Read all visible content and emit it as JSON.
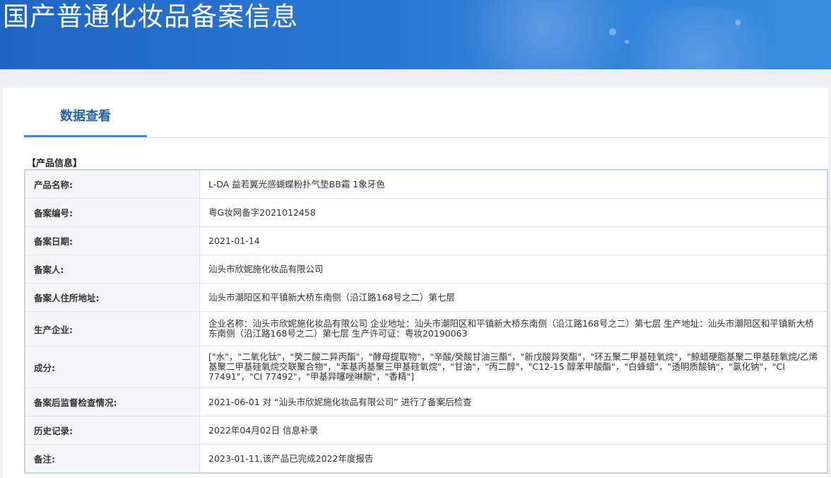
{
  "header": {
    "title": "国产普通化妆品备案信息"
  },
  "tabs": [
    {
      "label": "数据查看",
      "active": true
    }
  ],
  "section": {
    "title": "【产品信息】"
  },
  "rows": [
    {
      "label": "产品名称:",
      "value": "L-DA 益若翼光感蝴蝶粉扑气垫BB霜 1象牙色"
    },
    {
      "label": "备案编号:",
      "value": "粤G妆网备字2021012458"
    },
    {
      "label": "备案日期:",
      "value": "2021-01-14"
    },
    {
      "label": "备案人:",
      "value": "汕头市欣妮施化妆品有限公司"
    },
    {
      "label": "备案人住所地址:",
      "value": "汕头市潮阳区和平镇新大桥东南侧（沿江路168号之二）第七层"
    },
    {
      "label": "生产企业:",
      "value": "企业名称：汕头市欣妮施化妆品有限公司 企业地址：汕头市潮阳区和平镇新大桥东南侧（沿江路168号之二）第七层 生产地址：汕头市潮阳区和平镇新大桥东南侧（沿江路168号之二）第七层 生产许可证：粤妆20190063"
    },
    {
      "label": "成分:",
      "value": "[\"水\"，\"二氧化钛\"，\"癸二酸二异丙酯\"，\"酵母提取物\"，\"辛酸/癸酸甘油三酯\"，\"新戊酸异癸酯\"，\"环五聚二甲基硅氧烷\"，\"鲸蜡硬脂基聚二甲基硅氧烷/乙烯基聚二甲基硅氧烷交联聚合物\"，\"苯基丙基聚三甲基硅氧烷\"，\"甘油\"，\"丙二醇\"，\"C12-15 醇苯甲酸酯\"，\"白蜂蜡\"，\"透明质酸钠\"，\"氯化钠\"，\"CI 77491\"，\"CI 77492\"，\"甲基异噻唑啉酮\"，\"香精\"]"
    },
    {
      "label": "备案后监督检查情况:",
      "value": "2021-06-01 对 “汕头市欣妮施化妆品有限公司” 进行了备案后检查"
    },
    {
      "label": "历史记录:",
      "value": "2022年04月02日 信息补录"
    },
    {
      "label": "备注:",
      "value": "2023-01-11,该产品已完成2022年度报告"
    }
  ]
}
